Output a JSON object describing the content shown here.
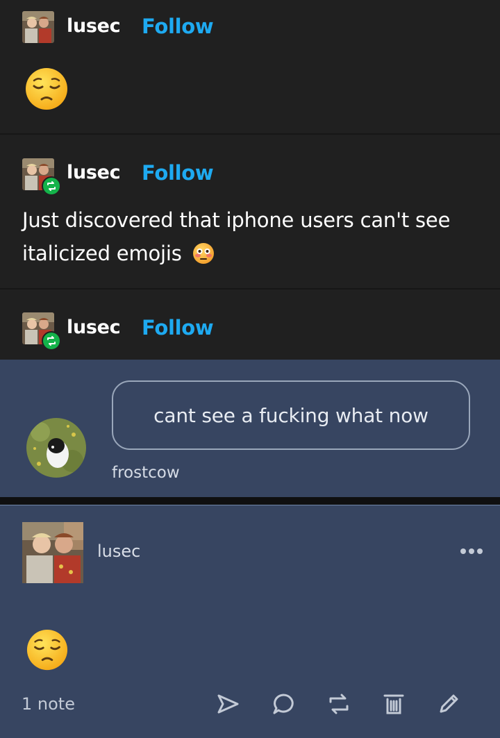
{
  "posts": [
    {
      "username": "lusec",
      "follow_label": "Follow",
      "reblog": false,
      "content_emoji": "pensive-face"
    },
    {
      "username": "lusec",
      "follow_label": "Follow",
      "reblog": true,
      "text": "Just discovered that iphone users can't see italicized emojis",
      "content_emoji": "flushed-face"
    },
    {
      "username": "lusec",
      "follow_label": "Follow",
      "reblog": true
    }
  ],
  "ask": {
    "message": "cant see a fucking what now",
    "asker": "frostcow"
  },
  "answer": {
    "username": "lusec",
    "content_emoji": "pensive-face"
  },
  "footer": {
    "notes": "1 note",
    "icons": [
      "share-icon",
      "reply-icon",
      "reblog-icon",
      "delete-icon",
      "edit-icon"
    ]
  },
  "colors": {
    "background_dark": "#202020",
    "ask_background": "#374561",
    "follow_link": "#1eaaf1",
    "reblog_badge": "#14b34a"
  }
}
